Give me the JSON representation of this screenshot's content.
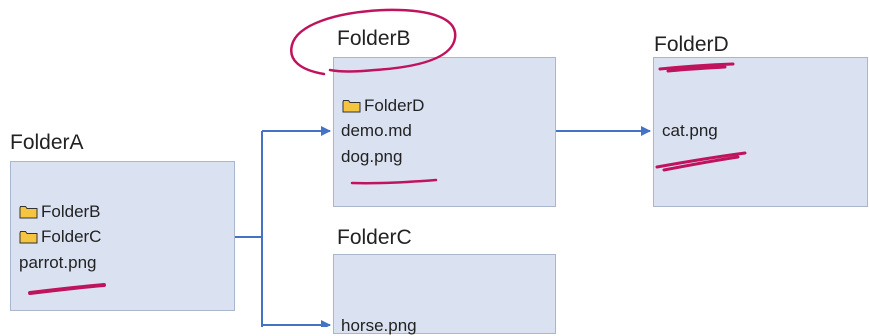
{
  "folders": {
    "A": {
      "title": "FolderA",
      "items": [
        {
          "label": "FolderB",
          "icon": "folder-icon"
        },
        {
          "label": "FolderC",
          "icon": "folder-icon"
        },
        {
          "label": "parrot.png"
        }
      ]
    },
    "B": {
      "title": "FolderB",
      "items": [
        {
          "label": "FolderD",
          "icon": "folder-icon"
        },
        {
          "label": "demo.md"
        },
        {
          "label": "dog.png"
        }
      ]
    },
    "C": {
      "title": "FolderC",
      "items": [
        {
          "label": "horse.png"
        }
      ]
    },
    "D": {
      "title": "FolderD",
      "items": [
        {
          "label": "cat.png"
        }
      ]
    }
  },
  "colors": {
    "box_fill": "#dae2f2",
    "arrow": "#4472c4",
    "annotation": "#c0135e"
  }
}
